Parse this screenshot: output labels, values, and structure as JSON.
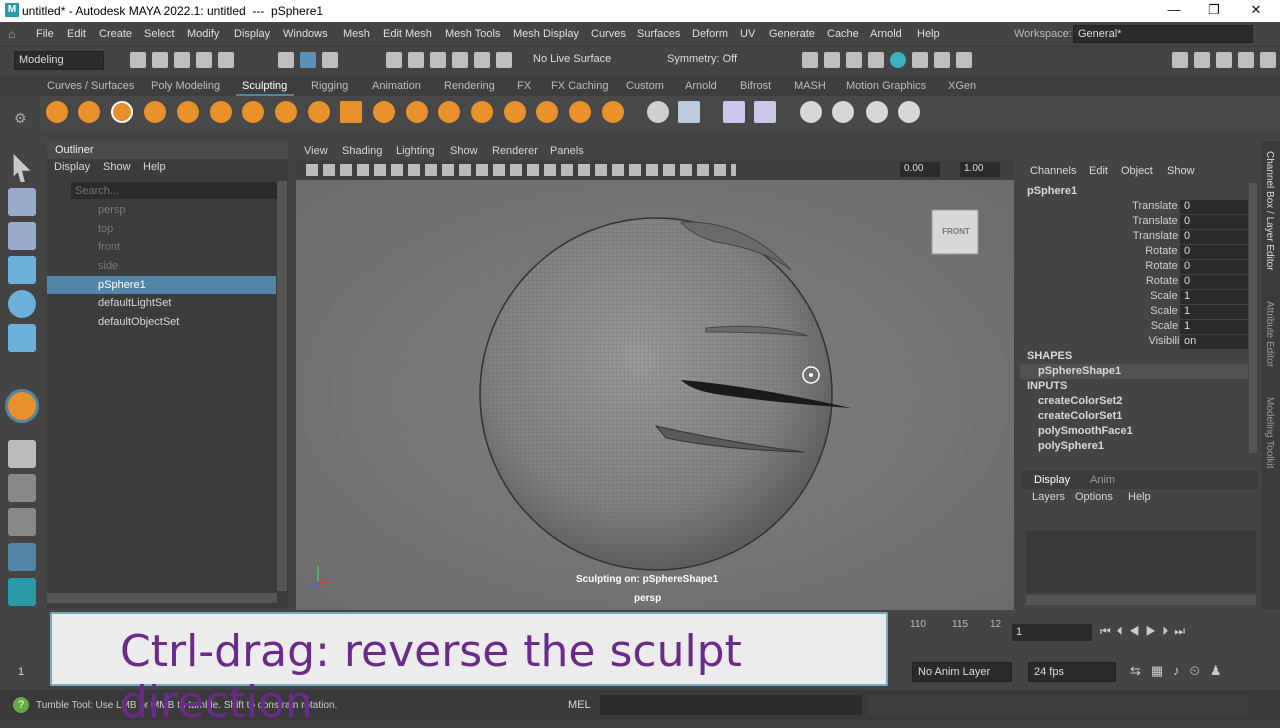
{
  "title": "untitled* - Autodesk MAYA 2022.1: untitled  ---  pSphere1",
  "window_controls": [
    "—",
    "❐",
    "✕"
  ],
  "menu": [
    "File",
    "Edit",
    "Create",
    "Select",
    "Modify",
    "Display",
    "Windows",
    "Mesh",
    "Edit Mesh",
    "Mesh Tools",
    "Mesh Display",
    "Curves",
    "Surfaces",
    "Deform",
    "UV",
    "Generate",
    "Cache",
    "Arnold",
    "Help"
  ],
  "workspace": {
    "label": "Workspace:",
    "value": "General*"
  },
  "statusline": {
    "mode": "Modeling",
    "live": "No Live Surface",
    "symmetry": "Symmetry: Off"
  },
  "shelf_tabs": [
    "Curves / Surfaces",
    "Poly Modeling",
    "Sculpting",
    "Rigging",
    "Animation",
    "Rendering",
    "FX",
    "FX Caching",
    "Custom",
    "Arnold",
    "Bifrost",
    "MASH",
    "Motion Graphics",
    "XGen"
  ],
  "shelf_active": "Sculpting",
  "outliner": {
    "title": "Outliner",
    "menu": [
      "Display",
      "Show",
      "Help"
    ],
    "search_placeholder": "Search...",
    "items": [
      {
        "label": "persp",
        "dim": true
      },
      {
        "label": "top",
        "dim": true
      },
      {
        "label": "front",
        "dim": true
      },
      {
        "label": "side",
        "dim": true
      },
      {
        "label": "pSphere1",
        "selected": true
      },
      {
        "label": "defaultLightSet"
      },
      {
        "label": "defaultObjectSet"
      }
    ]
  },
  "viewport": {
    "menu": [
      "View",
      "Shading",
      "Lighting",
      "Show",
      "Renderer",
      "Panels"
    ],
    "field1": "0.00",
    "field2": "1.00",
    "cube_label": "FRONT",
    "sculpt_status": "Sculpting on: pSphereShape1",
    "camera": "persp"
  },
  "channel_box": {
    "menu": [
      "Channels",
      "Edit",
      "Object",
      "Show"
    ],
    "object": "pSphere1",
    "attrs": [
      {
        "name": "Translate X",
        "value": "0"
      },
      {
        "name": "Translate Y",
        "value": "0"
      },
      {
        "name": "Translate Z",
        "value": "0"
      },
      {
        "name": "Rotate X",
        "value": "0"
      },
      {
        "name": "Rotate Y",
        "value": "0"
      },
      {
        "name": "Rotate Z",
        "value": "0"
      },
      {
        "name": "Scale X",
        "value": "1"
      },
      {
        "name": "Scale Y",
        "value": "1"
      },
      {
        "name": "Scale Z",
        "value": "1"
      },
      {
        "name": "Visibility",
        "value": "on"
      }
    ],
    "shapes_label": "SHAPES",
    "shape": "pSphereShape1",
    "inputs_label": "INPUTS",
    "inputs": [
      "createColorSet2",
      "createColorSet1",
      "polySmoothFace1",
      "polySphere1"
    ]
  },
  "layer_editor": {
    "tabs": [
      "Display",
      "Anim"
    ],
    "menu": [
      "Layers",
      "Options",
      "Help"
    ]
  },
  "side_tabs": [
    "Channel Box / Layer Editor",
    "Attribute Editor",
    "Modeling Toolkit"
  ],
  "timeline": {
    "ticks": [
      "110",
      "115",
      "12"
    ],
    "current": "1",
    "start": "1"
  },
  "range": {
    "anim_layer": "No Anim Layer",
    "fps": "24 fps"
  },
  "help_line": "Tumble Tool: Use LMB or MMB to tumble. Shift to constrain rotation.",
  "mel": "MEL",
  "caption": "Ctrl-drag: reverse the sculpt direction"
}
